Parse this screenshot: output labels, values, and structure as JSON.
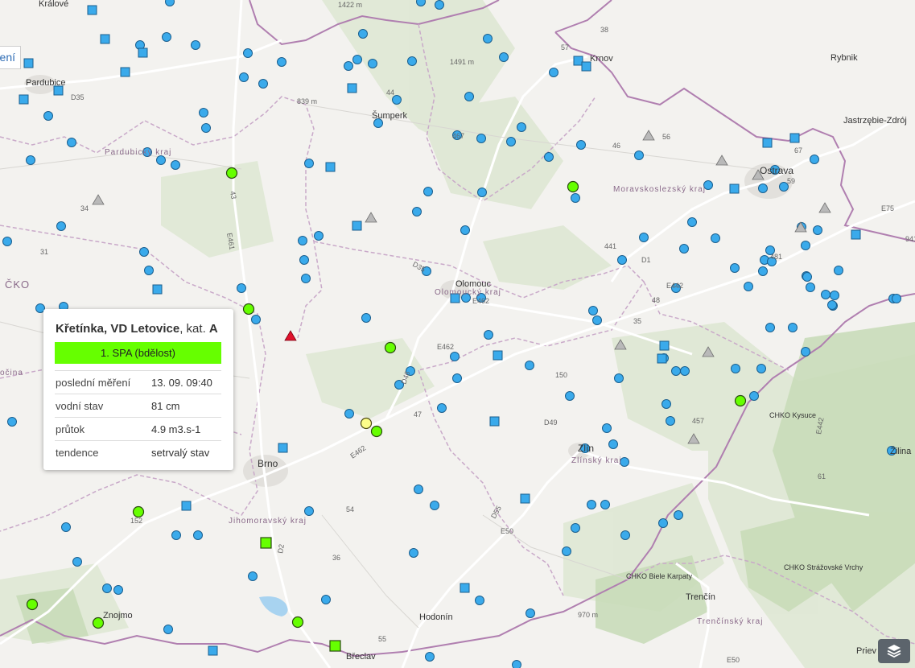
{
  "left_tab": {
    "label": "ení"
  },
  "cities": [
    {
      "name": "Králové"
    },
    {
      "name": "Pardubice"
    },
    {
      "name": "Šumperk"
    },
    {
      "name": "Krnov"
    },
    {
      "name": "Rybnik"
    },
    {
      "name": "Jastrzębie-Zdrój"
    },
    {
      "name": "Ostrava"
    },
    {
      "name": "Olomouc"
    },
    {
      "name": "Brno"
    },
    {
      "name": "Zlín"
    },
    {
      "name": "Znojmo"
    },
    {
      "name": "Hodonín"
    },
    {
      "name": "Břeclav"
    },
    {
      "name": "Trenčín"
    },
    {
      "name": "Žilina"
    },
    {
      "name": "Priev"
    }
  ],
  "regions": [
    {
      "name": "Pardubický kraj"
    },
    {
      "name": "Olomoucký kraj"
    },
    {
      "name": "Moravskoslezský kraj"
    },
    {
      "name": "Jihomoravský kraj"
    },
    {
      "name": "Zlínský kraj"
    },
    {
      "name": "Trenčínský kraj"
    },
    {
      "name": "ČKO"
    },
    {
      "name": "očina"
    }
  ],
  "protected_areas": [
    {
      "name": "CHKO Kysuce"
    },
    {
      "name": "CHKO Biele Karpaty"
    },
    {
      "name": "CHKO Strážovské Vrchy"
    }
  ],
  "elevations": [
    "1422 m",
    "1491 m",
    "839 m",
    "970 m"
  ],
  "road_labels": [
    "D35",
    "38",
    "E462",
    "46",
    "56",
    "67",
    "59",
    "E75",
    "47",
    "D1",
    "441",
    "E442",
    "D46",
    "150",
    "D49",
    "E462",
    "E50",
    "D55",
    "D2",
    "54",
    "36",
    "55",
    "152",
    "43",
    "E461",
    "31",
    "34",
    "57",
    "44",
    "E462",
    "481",
    "E50",
    "61",
    "E442",
    "941",
    "D35",
    "35",
    "48",
    "457",
    "467"
  ],
  "stations": [
    {
      "status": "normal"
    },
    {
      "status": "spa1"
    },
    {
      "status": "spa2"
    },
    {
      "status": "spa3"
    },
    {
      "status": "inactive"
    }
  ],
  "colors": {
    "station_normal": "#3aaaeb",
    "spa1_green": "#66ff00",
    "spa2_yellow": "#fdfd8a",
    "spa3_red": "#e0102b",
    "inactive_gray": "#b9b9b9",
    "border_purple": "#b07fb0"
  },
  "tooltip": {
    "station_name": "Křetínka, VD Letovice",
    "category_prefix": ", kat. ",
    "category": "A",
    "status_label": "1. SPA (bdělost)",
    "rows": [
      {
        "label": "poslední měření",
        "value": "13. 09. 09:40"
      },
      {
        "label": "vodní stav",
        "value": "81 cm"
      },
      {
        "label": "průtok",
        "value": "4.9 m3.s-1"
      },
      {
        "label": "tendence",
        "value": "setrvalý stav"
      }
    ]
  },
  "layers_button": {
    "icon": "layers-icon"
  }
}
